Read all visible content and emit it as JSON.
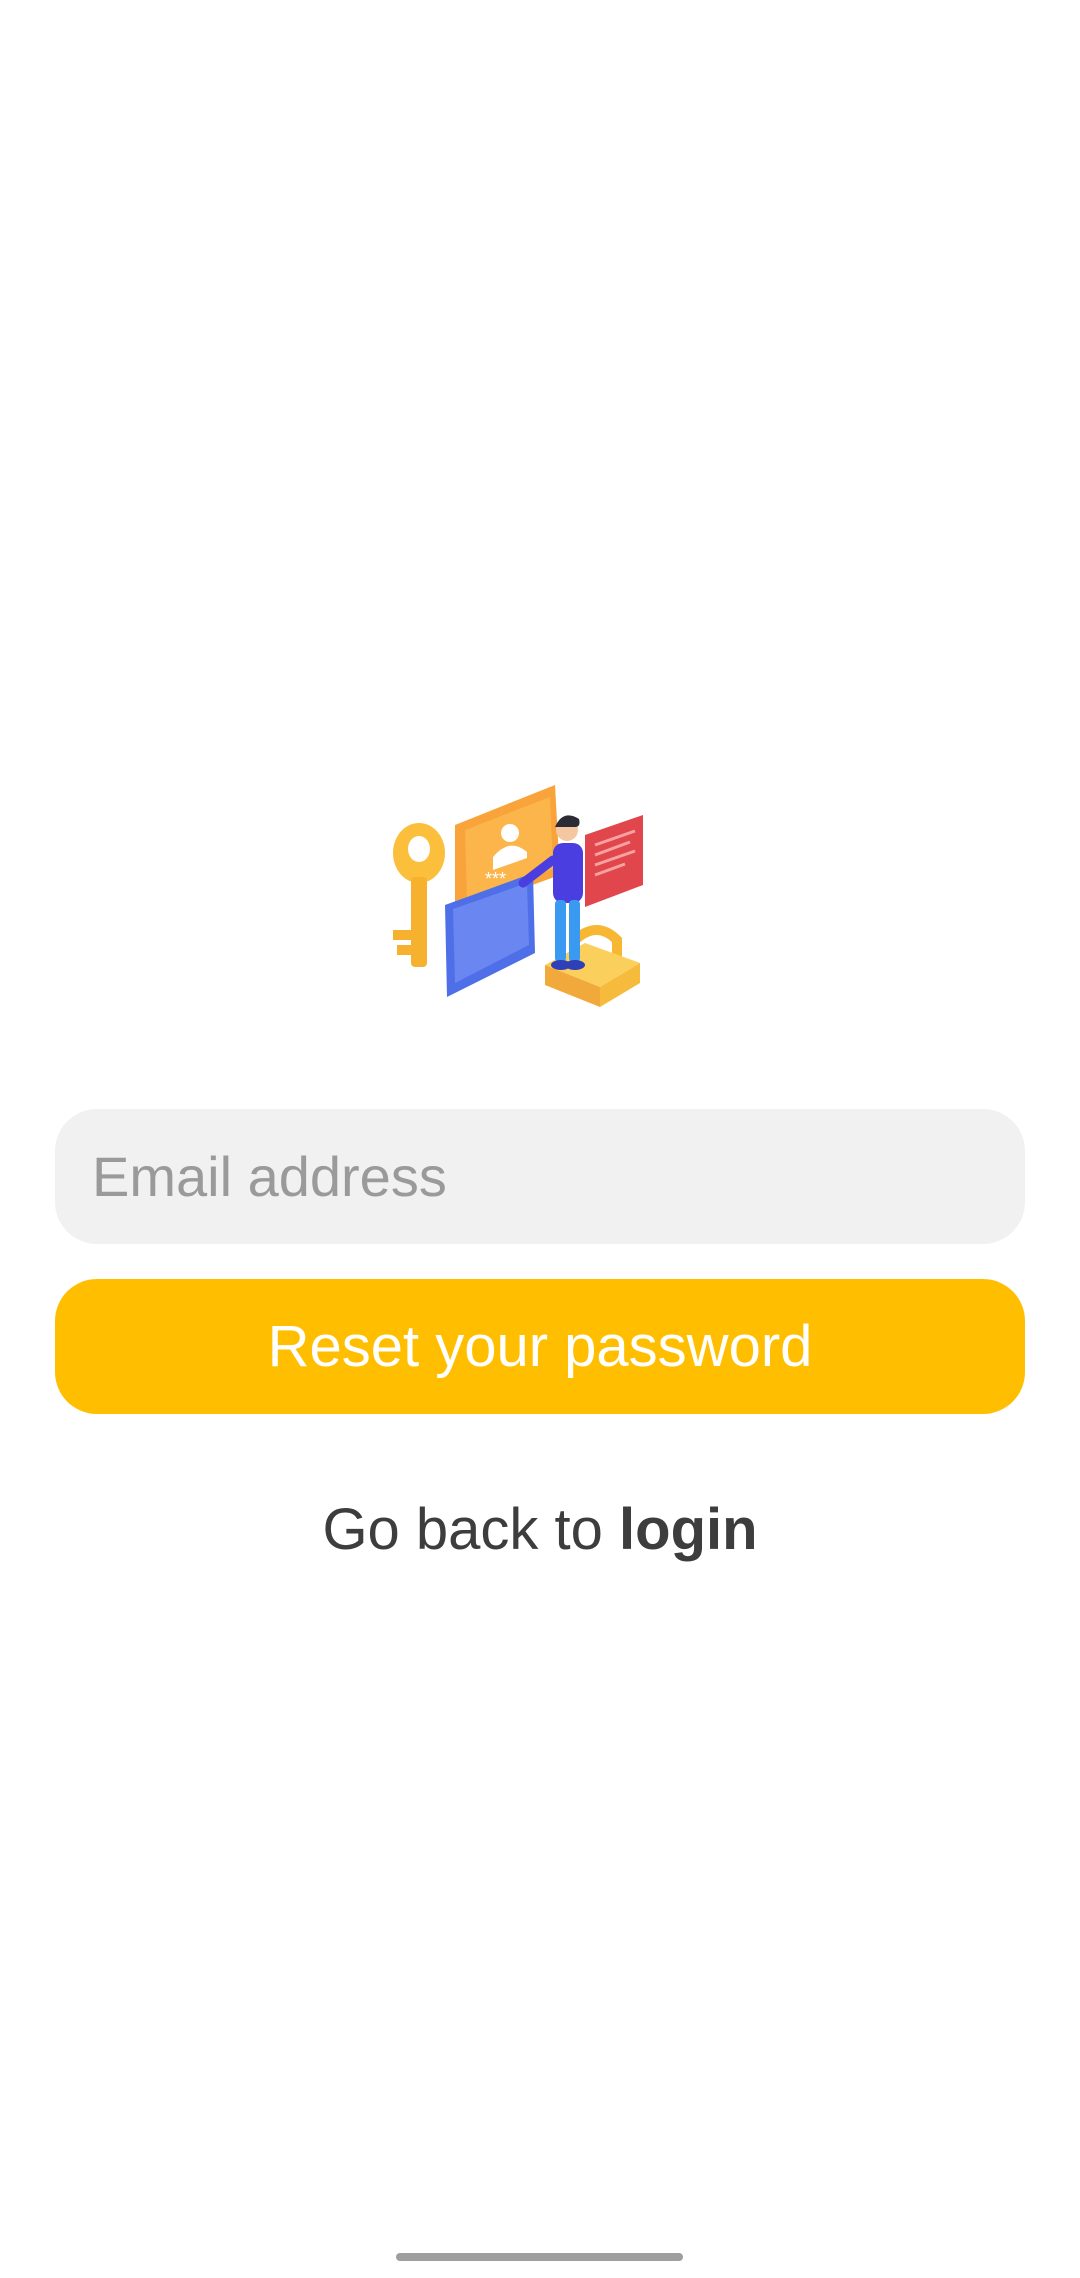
{
  "illustration": {
    "icon": "password-reset-illustration",
    "password_mask": "***"
  },
  "form": {
    "email_placeholder": "Email address",
    "email_value": "",
    "reset_label": "Reset your password"
  },
  "footer": {
    "prefix": "Go back to ",
    "login_label": "login"
  },
  "colors": {
    "accent": "#FFBF00",
    "field_bg": "#F1F1F1",
    "text": "#3D3D3D",
    "placeholder": "#9A9A9A"
  }
}
